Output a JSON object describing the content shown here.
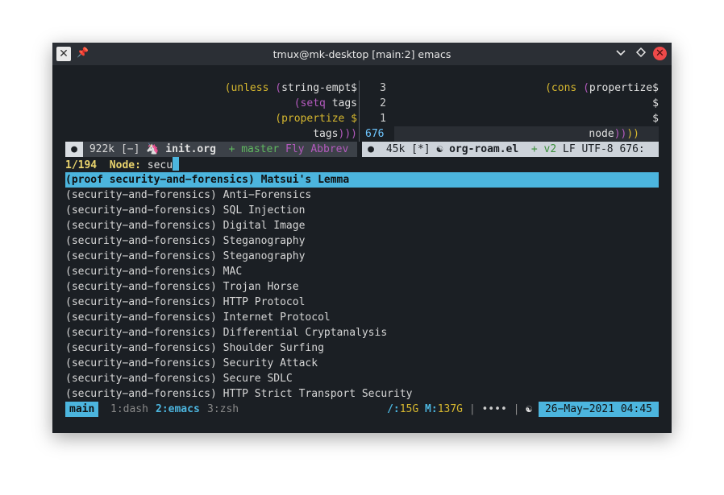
{
  "window": {
    "title": "tmux@mk-desktop [main:2] emacs",
    "app_icon": "x-app-icon",
    "controls": [
      "pin-icon",
      "minimize-icon",
      "maximize-icon",
      "close-icon"
    ]
  },
  "editor": {
    "left_pane": [
      {
        "parts": [
          [
            "yellow",
            "(unless "
          ],
          [
            "magenta",
            "("
          ],
          [
            "white",
            "string-empt$"
          ]
        ]
      },
      {
        "parts": [
          [
            "magenta",
            "(setq "
          ],
          [
            "white",
            "tags"
          ]
        ]
      },
      {
        "parts": [
          [
            "yellow",
            "(propertize $"
          ]
        ]
      },
      {
        "parts": [
          [
            "white",
            "tags"
          ],
          [
            "magenta",
            ")))"
          ]
        ]
      }
    ],
    "right_pane": [
      {
        "num": "3",
        "parts": [
          [
            "yellow",
            "(cons "
          ],
          [
            "magenta",
            "("
          ],
          [
            "white",
            "propertize$"
          ]
        ]
      },
      {
        "num": "2",
        "parts": [
          [
            "white",
            "$"
          ]
        ]
      },
      {
        "num": "1",
        "parts": [
          [
            "white",
            "$"
          ]
        ]
      },
      {
        "num": "676",
        "parts": [
          [
            "white",
            "node"
          ],
          [
            "magenta",
            "))"
          ],
          [
            "yellow",
            "))"
          ]
        ]
      }
    ],
    "modeline_left": {
      "dot": "●",
      "size": "922k",
      "flags": "[−]",
      "buffer": "init.org",
      "vc": "+ master",
      "modes": "Fly Abbrev"
    },
    "modeline_right": {
      "dot": "●",
      "size": "45k",
      "flags": "[*]",
      "buffer": "org-roam.el",
      "vc": "+ v2",
      "encoding": "LF UTF-8",
      "position": "676:"
    }
  },
  "minibuffer": {
    "count": "1/194",
    "prompt": "Node:",
    "input": "secu",
    "selected": "(proof security−and−forensics) Matsui's Lemma",
    "candidates": [
      "(security−and−forensics) Anti−Forensics",
      "(security−and−forensics) SQL Injection",
      "(security−and−forensics) Digital Image",
      "(security−and−forensics) Steganography",
      "(security−and−forensics) Steganography",
      "(security−and−forensics) MAC",
      "(security−and−forensics) Trojan Horse",
      "(security−and−forensics) HTTP Protocol",
      "(security−and−forensics) Internet Protocol",
      "(security−and−forensics) Differential Cryptanalysis",
      "(security−and−forensics) Shoulder Surfing",
      "(security−and−forensics) Security Attack",
      "(security−and−forensics) Secure SDLC",
      "(security−and−forensics) HTTP Strict Transport Security"
    ]
  },
  "tmux": {
    "session": "main",
    "windows": [
      {
        "label": "1:dash",
        "active": false
      },
      {
        "label": "2:emacs",
        "active": true
      },
      {
        "label": "3:zsh",
        "active": false
      }
    ],
    "disk_root_label": "/:",
    "disk_root_value": "15G",
    "mem_label": "M:",
    "mem_value": "137G",
    "separator": "|",
    "dots": "••••",
    "date": "26−May−2021 04:45"
  },
  "colors": {
    "accent": "#4cb5de",
    "background": "#1b1f24",
    "yellow": "#d7b82f",
    "magenta": "#b45abe",
    "green": "#5fb85f"
  }
}
